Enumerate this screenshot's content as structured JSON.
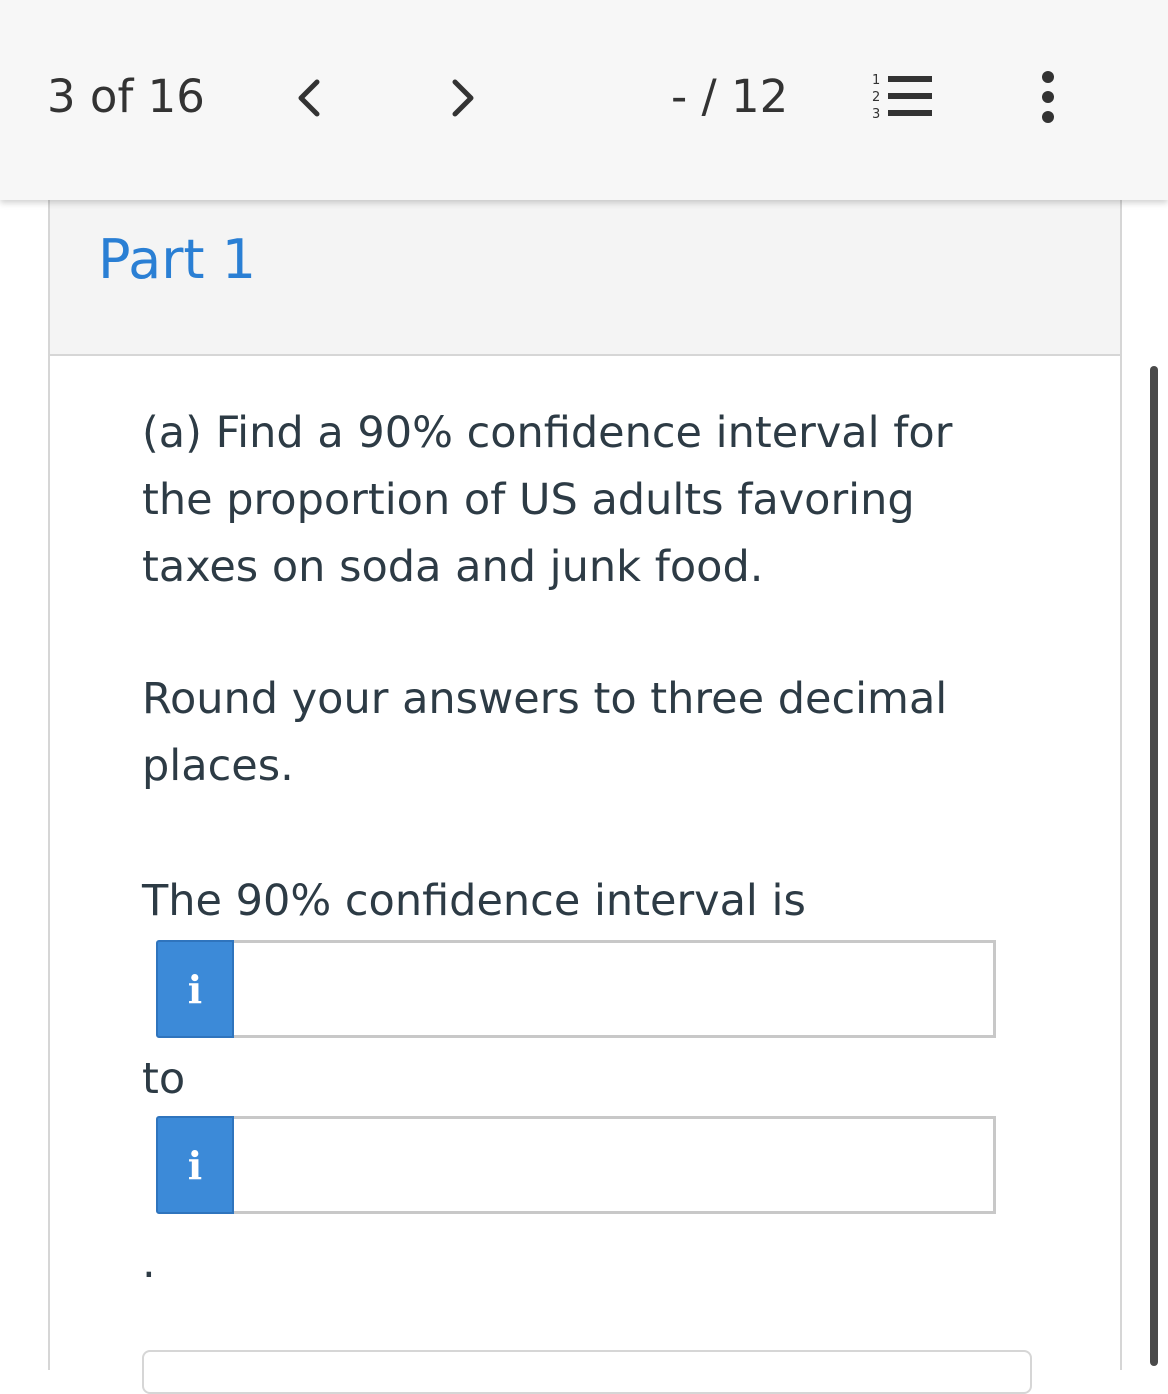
{
  "nav": {
    "counter": "3 of 16",
    "score": "- / 12",
    "prev_icon": "chevron-left-icon",
    "next_icon": "chevron-right-icon",
    "list_icon": "numbered-list-icon",
    "more_icon": "more-vertical-icon"
  },
  "part": {
    "title": "Part 1"
  },
  "question": {
    "text": "(a) Find a 90% confidence interval for the proportion of US adults favoring taxes on soda and junk food.",
    "instruction": "Round your answers to three decimal places.",
    "prompt": "The 90% confidence interval is",
    "connector": "to",
    "terminator": "."
  },
  "answers": [
    {
      "info_label": "i",
      "value": ""
    },
    {
      "info_label": "i",
      "value": ""
    }
  ],
  "colors": {
    "accent": "#2a7fd4",
    "info_button": "#3c8ad8",
    "text": "#2d3b45"
  }
}
